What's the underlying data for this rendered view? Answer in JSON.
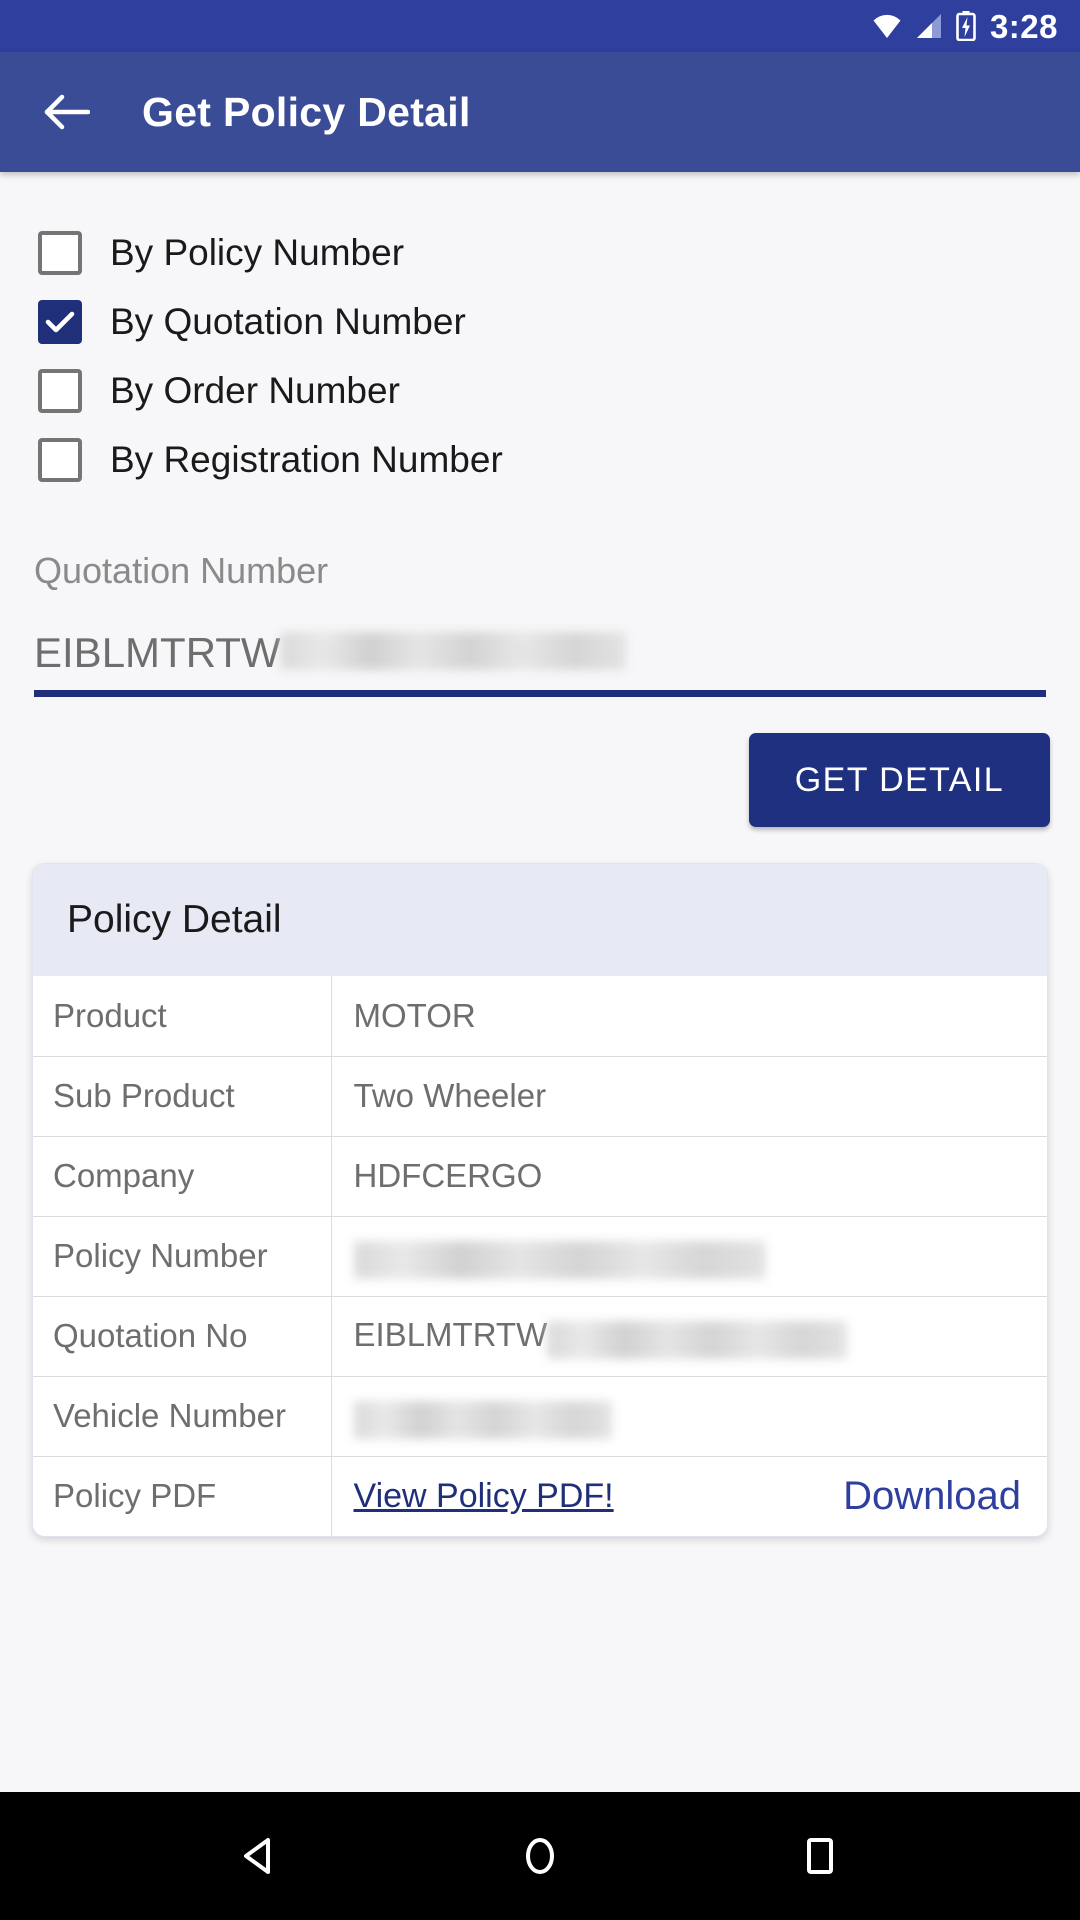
{
  "status_bar": {
    "time": "3:28",
    "icons": [
      "wifi-icon",
      "signal-icon",
      "battery-charging-icon"
    ]
  },
  "app_bar": {
    "back_icon": "back-arrow-icon",
    "title": "Get Policy Detail"
  },
  "search_options": {
    "items": [
      {
        "label": "By Policy Number",
        "checked": false
      },
      {
        "label": "By Quotation Number",
        "checked": true
      },
      {
        "label": "By Order Number",
        "checked": false
      },
      {
        "label": "By Registration Number",
        "checked": false
      }
    ]
  },
  "input_field": {
    "label": "Quotation Number",
    "value_visible": "EIBLMTRTW",
    "value_redacted": true,
    "placeholder": "Quotation Number"
  },
  "actions": {
    "get_detail_label": "GET DETAIL"
  },
  "policy_card": {
    "title": "Policy Detail",
    "rows": [
      {
        "key": "Product",
        "value": "MOTOR",
        "redacted": false
      },
      {
        "key": "Sub Product",
        "value": "Two Wheeler",
        "redacted": false
      },
      {
        "key": "Company",
        "value": "HDFCERGO",
        "redacted": false
      },
      {
        "key": "Policy Number",
        "value": "",
        "redacted": true
      },
      {
        "key": "Quotation No",
        "value": "EIBLMTRTW",
        "redacted": true
      },
      {
        "key": "Vehicle Number",
        "value": "",
        "redacted": true
      }
    ],
    "pdf_row": {
      "key": "Policy PDF",
      "view_label": "View Policy PDF!",
      "download_label": "Download"
    }
  },
  "nav_bar": {
    "back_label": "back-triangle-icon",
    "home_label": "home-circle-icon",
    "recents_label": "recents-square-icon"
  },
  "colors": {
    "status_bar": "#2f3f9e",
    "app_bar": "#3b4c96",
    "accent": "#1f2f7a",
    "button": "#1f3080",
    "card_header": "#e7e9f5",
    "page_bg": "#f7f7f9",
    "link": "#2f3f9e"
  }
}
